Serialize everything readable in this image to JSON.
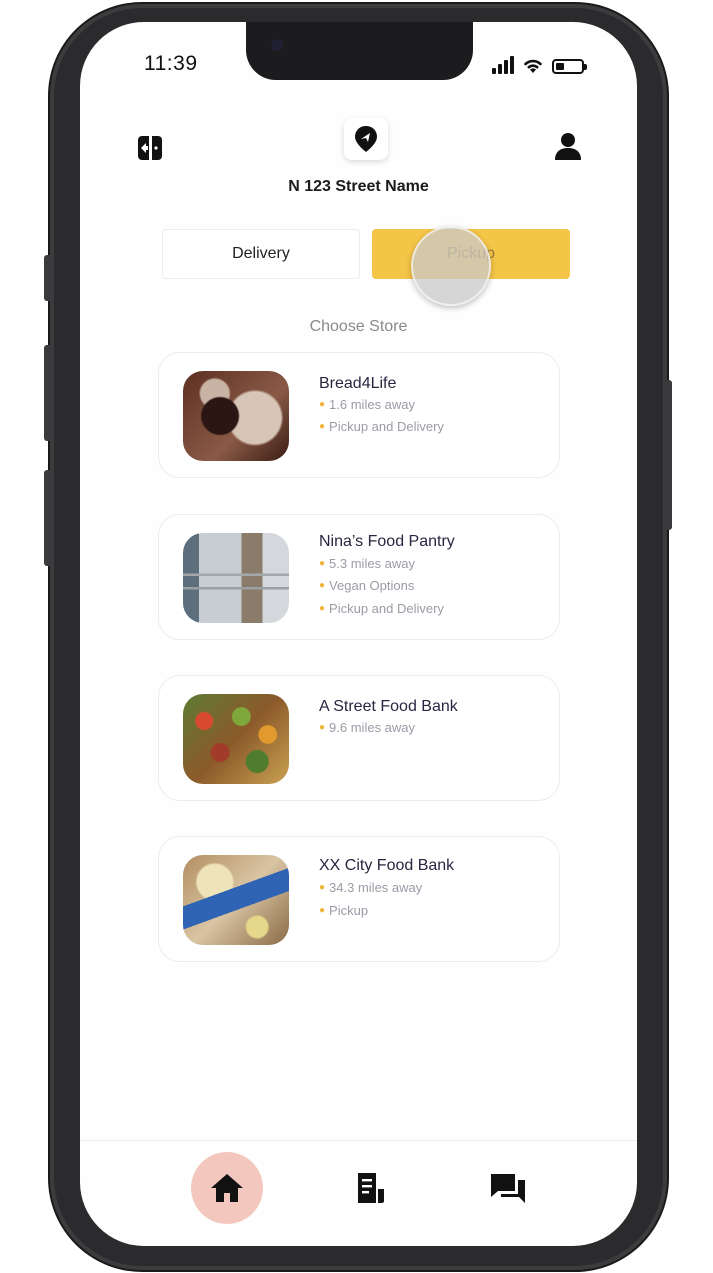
{
  "status_bar": {
    "time": "11:39"
  },
  "header": {
    "address": "N 123 Street Name"
  },
  "toggle": {
    "delivery_label": "Delivery",
    "pickup_label": "Pickup",
    "selected": "Pickup"
  },
  "choose_label": "Choose Store",
  "stores": [
    {
      "name": "Bread4Life",
      "details": [
        "1.6 miles away",
        "Pickup and Delivery"
      ]
    },
    {
      "name": "Nina’s Food Pantry",
      "details": [
        "5.3 miles away",
        "Vegan Options",
        "Pickup and Delivery"
      ]
    },
    {
      "name": "A Street Food Bank",
      "details": [
        "9.6 miles away"
      ]
    },
    {
      "name": "XX City Food Bank",
      "details": [
        "34.3 miles away",
        "Pickup"
      ]
    }
  ],
  "bottom_nav": {
    "items": [
      "home-icon",
      "document-icon",
      "chat-icon"
    ],
    "active": "home-icon"
  },
  "colors": {
    "accent": "#f5c548",
    "home_highlight": "#f3c7bd",
    "bullet": "#f0b53a"
  }
}
